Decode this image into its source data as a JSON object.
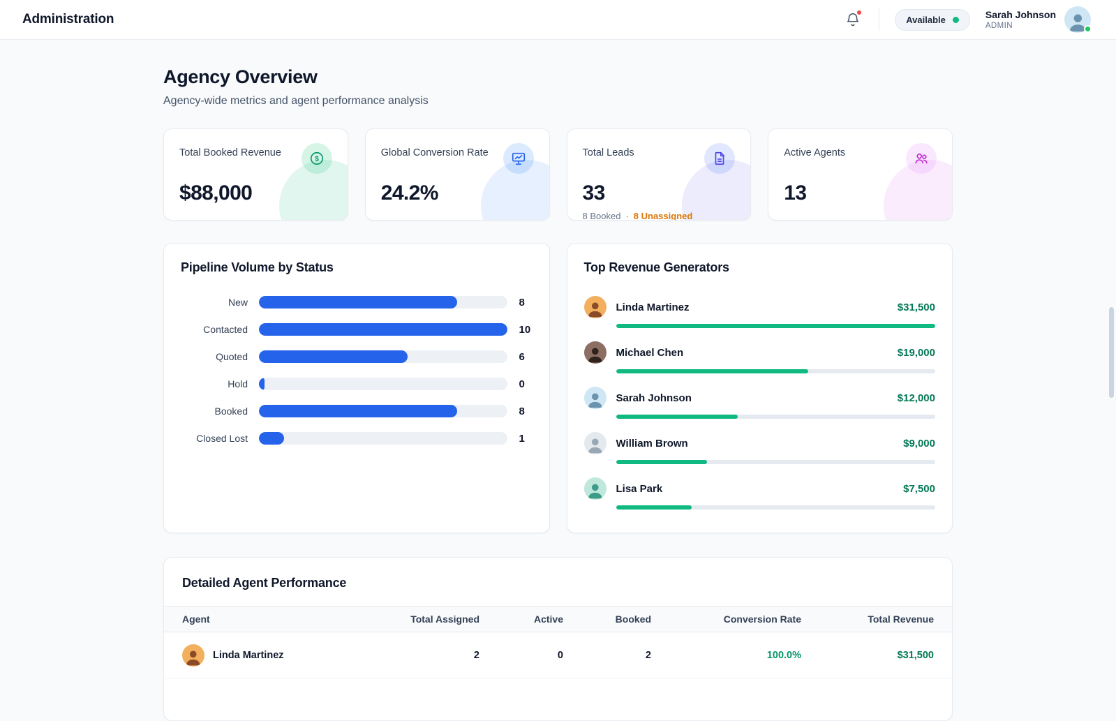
{
  "header": {
    "title": "Administration",
    "status_label": "Available",
    "user_name": "Sarah Johnson",
    "user_role": "ADMIN",
    "user_avatar": {
      "bg": "#cfe6f5",
      "fg": "#6b93ad"
    }
  },
  "page": {
    "title": "Agency Overview",
    "subtitle": "Agency-wide metrics and agent performance analysis"
  },
  "stats": [
    {
      "label": "Total Booked Revenue",
      "value": "$88,000",
      "icon": "dollar-circle-icon",
      "accent": "#10b981"
    },
    {
      "label": "Global Conversion Rate",
      "value": "24.2%",
      "icon": "presentation-chart-icon",
      "accent": "#3b82f6"
    },
    {
      "label": "Total Leads",
      "value": "33",
      "sub_booked": "8 Booked",
      "sub_separator": "·",
      "sub_unassigned": "8 Unassigned",
      "icon": "document-icon",
      "accent": "#6366f1"
    },
    {
      "label": "Active Agents",
      "value": "13",
      "icon": "users-group-icon",
      "accent": "#d946ef"
    }
  ],
  "pipeline": {
    "title": "Pipeline Volume by Status",
    "type": "bar",
    "max": 10,
    "bar_color": "#2563eb",
    "rows": [
      {
        "label": "New",
        "value": 8
      },
      {
        "label": "Contacted",
        "value": 10
      },
      {
        "label": "Quoted",
        "value": 6
      },
      {
        "label": "Hold",
        "value": 0
      },
      {
        "label": "Booked",
        "value": 8
      },
      {
        "label": "Closed Lost",
        "value": 1
      }
    ]
  },
  "top_revenue": {
    "title": "Top Revenue Generators",
    "max": 31500,
    "bar_color": "#10b981",
    "items": [
      {
        "name": "Linda Martinez",
        "amount": "$31,500",
        "value": 31500,
        "avatar_bg": "#f2b05e",
        "avatar_fg": "#8a4b26"
      },
      {
        "name": "Michael Chen",
        "amount": "$19,000",
        "value": 19000,
        "avatar_bg": "#8d6e63",
        "avatar_fg": "#2f221b"
      },
      {
        "name": "Sarah Johnson",
        "amount": "$12,000",
        "value": 12000,
        "avatar_bg": "#cfe6f5",
        "avatar_fg": "#6b93ad"
      },
      {
        "name": "William Brown",
        "amount": "$9,000",
        "value": 9000,
        "avatar_bg": "#e4e9ee",
        "avatar_fg": "#9aa7b5"
      },
      {
        "name": "Lisa Park",
        "amount": "$7,500",
        "value": 7500,
        "avatar_bg": "#bfe8dc",
        "avatar_fg": "#3d9b87"
      }
    ]
  },
  "agent_table": {
    "title": "Detailed Agent Performance",
    "columns": [
      "Agent",
      "Total Assigned",
      "Active",
      "Booked",
      "Conversion Rate",
      "Total Revenue"
    ],
    "rows": [
      {
        "agent": "Linda Martinez",
        "total_assigned": "2",
        "active": "0",
        "booked": "2",
        "conversion_rate": "100.0%",
        "total_revenue": "$31,500",
        "avatar_bg": "#f2b05e",
        "avatar_fg": "#8a4b26"
      }
    ]
  }
}
